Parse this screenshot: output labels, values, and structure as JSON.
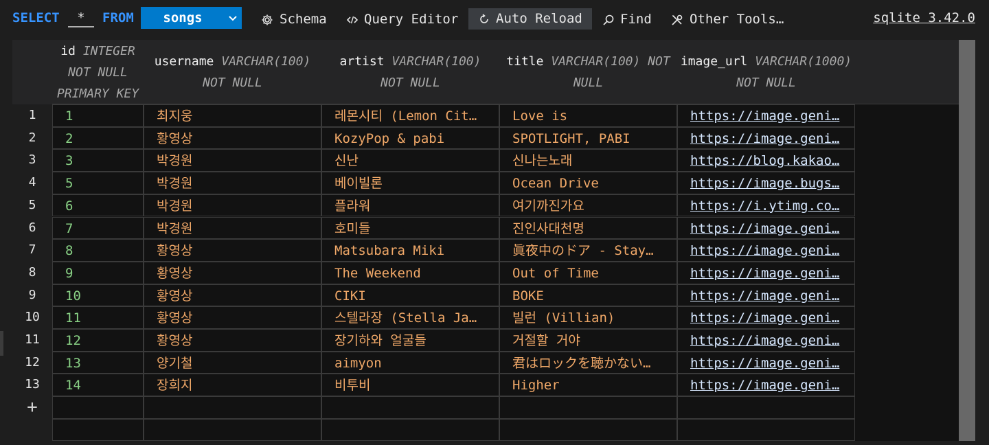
{
  "toolbar": {
    "select_kw": "SELECT",
    "star": "*",
    "from_kw": "FROM",
    "table_name": "songs",
    "schema_label": "Schema",
    "query_editor_label": "Query Editor",
    "auto_reload_label": "Auto Reload",
    "find_label": "Find",
    "other_tools_label": "Other Tools…",
    "version": "sqlite 3.42.0"
  },
  "columns": [
    {
      "name": "id",
      "type_lines": [
        "INTEGER",
        "NOT NULL",
        "PRIMARY KEY"
      ]
    },
    {
      "name": "username",
      "type_lines": [
        "VARCHAR(100)",
        "NOT NULL"
      ]
    },
    {
      "name": "artist",
      "type_lines": [
        "VARCHAR(100)",
        "NOT NULL"
      ]
    },
    {
      "name": "title",
      "type_lines": [
        "VARCHAR(100) NOT",
        "NULL"
      ]
    },
    {
      "name": "image_url",
      "type_lines": [
        "VARCHAR(1000) NOT NULL"
      ]
    }
  ],
  "rows": [
    {
      "num": "1",
      "id": "1",
      "username": "최지웅",
      "artist": "레몬시티 (Lemon Cit…",
      "title": "Love is",
      "image_url": "https://image.geni…"
    },
    {
      "num": "2",
      "id": "2",
      "username": "황영상",
      "artist": "KozyPop & pabi",
      "title": "SPOTLIGHT, PABI",
      "image_url": "https://image.geni…"
    },
    {
      "num": "3",
      "id": "3",
      "username": "박경원",
      "artist": "신난",
      "title": "신나는노래",
      "image_url": "https://blog.kakao…"
    },
    {
      "num": "4",
      "id": "5",
      "username": "박경원",
      "artist": "베이빌론",
      "title": "Ocean Drive",
      "image_url": "https://image.bugs…"
    },
    {
      "num": "5",
      "id": "6",
      "username": "박경원",
      "artist": "플라워",
      "title": "여기까진가요",
      "image_url": "https://i.ytimg.co…"
    },
    {
      "num": "6",
      "id": "7",
      "username": "박경원",
      "artist": "호미들",
      "title": "진인사대천명",
      "image_url": "https://image.geni…"
    },
    {
      "num": "7",
      "id": "8",
      "username": "황영상",
      "artist": "Matsubara Miki",
      "title": "眞夜中のドア - Stay…",
      "image_url": "https://image.geni…"
    },
    {
      "num": "8",
      "id": "9",
      "username": "황영상",
      "artist": "The Weekend",
      "title": "Out of Time",
      "image_url": "https://image.geni…"
    },
    {
      "num": "9",
      "id": "10",
      "username": "황영상",
      "artist": "CIKI",
      "title": "BOKE",
      "image_url": "https://image.geni…"
    },
    {
      "num": "10",
      "id": "11",
      "username": "황영상",
      "artist": "스텔라장 (Stella Ja…",
      "title": "빌런 (Villian)",
      "image_url": "https://image.geni…"
    },
    {
      "num": "11",
      "id": "12",
      "username": "황영상",
      "artist": "장기하와 얼굴들",
      "title": "거절할 거야",
      "image_url": "https://image.geni…"
    },
    {
      "num": "12",
      "id": "13",
      "username": "양기철",
      "artist": "aimyon",
      "title": "君はロックを聴かない…",
      "image_url": "https://image.geni…"
    },
    {
      "num": "13",
      "id": "14",
      "username": "장희지",
      "artist": "비투비",
      "title": "Higher",
      "image_url": "https://image.geni…"
    }
  ],
  "new_row_symbol": "+",
  "colors": {
    "keyword": "#3794ff",
    "table_select_bg": "#007acc",
    "id_text": "#89d185",
    "value_text": "#f0a868",
    "url_text": "#d7e8ff"
  }
}
